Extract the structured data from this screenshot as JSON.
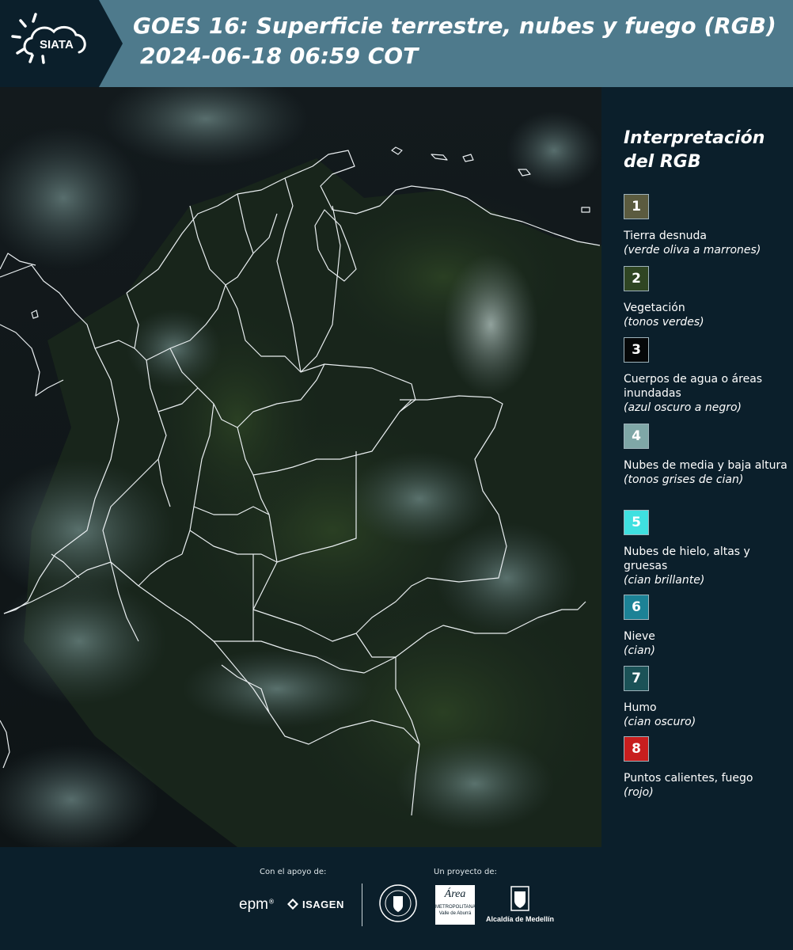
{
  "header": {
    "logo_text": "SIATA",
    "title_line1": "GOES 16: Superficie terrestre, nubes y fuego (RGB)",
    "title_line2": "2024-06-18 06:59 COT"
  },
  "legend": {
    "title": "Interpretación del RGB",
    "items": [
      {
        "number": "1",
        "label": "Tierra desnuda",
        "desc": "(verde oliva a marrones)",
        "color": "#5b5b3f"
      },
      {
        "number": "2",
        "label": "Vegetación",
        "desc": "(tonos verdes)",
        "color": "#2f4523"
      },
      {
        "number": "3",
        "label": "Cuerpos de agua o áreas inundadas",
        "desc": "(azul oscuro a negro)",
        "color": "#050708"
      },
      {
        "number": "4",
        "label": "Nubes de media y baja altura",
        "desc": "(tonos grises de cian)",
        "color": "#7fa7a7"
      },
      {
        "number": "5",
        "label": "Nubes de hielo, altas y gruesas",
        "desc": "(cian brillante)",
        "color": "#3fe0e0"
      },
      {
        "number": "6",
        "label": "Nieve",
        "desc": "(cian)",
        "color": "#1c8296"
      },
      {
        "number": "7",
        "label": "Humo",
        "desc": "(cian oscuro)",
        "color": "#1b5257"
      },
      {
        "number": "8",
        "label": "Puntos calientes, fuego",
        "desc": "(rojo)",
        "color": "#c81e1e"
      }
    ]
  },
  "footer": {
    "support_caption": "Con el apoyo de:",
    "project_caption": "Un proyecto de:",
    "sponsors": {
      "epm": "epm",
      "isagen": "ISAGEN",
      "area_line1": "Área",
      "area_line2": "METROPOLITANA",
      "area_line3": "Valle de Aburrá",
      "alcaldia": "Alcaldía de Medellín"
    }
  }
}
